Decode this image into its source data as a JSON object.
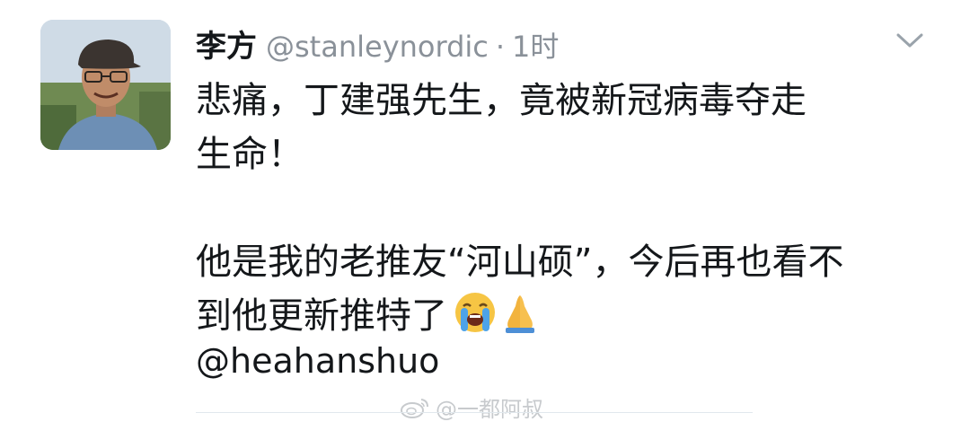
{
  "tweet": {
    "author_name": "李方",
    "handle": "@stanleynordic",
    "separator": "·",
    "time": "1时",
    "lines": [
      "悲痛，丁建强先生，竟被新冠病毒夺走",
      "生命！",
      "他是我的老推友“河山硕”，今后再也看不",
      "到他更新推特了"
    ],
    "emojis": [
      "loudly-crying-face-icon",
      "folded-hands-icon"
    ],
    "mention": "@heahanshuo"
  },
  "watermark": {
    "text": "@一都阿叔",
    "icon": "weibo-logo-icon"
  },
  "colors": {
    "text": "#14171a",
    "muted": "#8a9199",
    "divider": "#e1e8ed"
  }
}
